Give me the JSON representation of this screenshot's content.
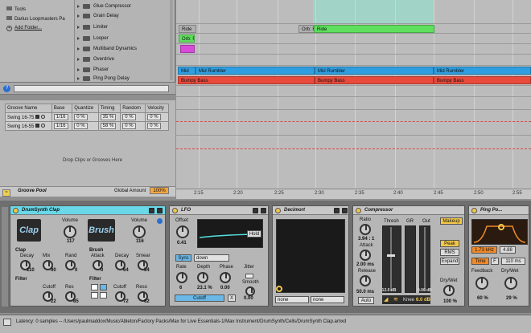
{
  "browser": {
    "places": [
      "Tools",
      "Darius Loopmasters Pa",
      "Add Folder..."
    ],
    "devices": [
      "Glue Compressor",
      "Grain Delay",
      "Limiter",
      "Looper",
      "Multiband Dynamics",
      "Overdrive",
      "Phaser",
      "Ping Pong Delay"
    ]
  },
  "search": {
    "icon": "search-icon",
    "value": ""
  },
  "groove": {
    "headers": [
      "Groove Name",
      "Base",
      "Quantize",
      "Timing",
      "Random",
      "Velocity"
    ],
    "rows": [
      {
        "name": "Swing 16-75",
        "base": "1/16",
        "quantize": "0 %",
        "timing": "35 %",
        "random": "0 %",
        "velocity": "0 %"
      },
      {
        "name": "Swing 16-55",
        "base": "1/16",
        "quantize": "0 %",
        "timing": "58 %",
        "random": "0 %",
        "velocity": "0 %"
      }
    ],
    "drop_hint": "Drop Clips or Grooves Here",
    "title": "Groove Pool",
    "global_amount_label": "Global Amount",
    "global_amount": "100%"
  },
  "arrangement": {
    "clips": {
      "ride_small": "Ride",
      "orb_ride": "Orb: R",
      "ride_main": "Ride",
      "orb_small": "Orb: R",
      "mid_a": "Mid",
      "mid_rumbler_1": "Mid Rumbler",
      "mid_rumbler_2": "Mid Rumbler",
      "mid_rumbler_3": "Mid Rumbler",
      "bumpy_1": "Bumpy Bass",
      "bumpy_2": "Bumpy Bass",
      "bumpy_3": "Bumpy Bass"
    },
    "ticks": [
      "2:15",
      "2:20",
      "2:25",
      "2:30",
      "2:35",
      "2:40",
      "2:45",
      "2:50",
      "2:55"
    ]
  },
  "drumsynth": {
    "title": "DrumSynth Clap",
    "clap_pad": "Clap",
    "brush_pad": "Brush",
    "volume_label": "Volume",
    "clap_volume": "117",
    "brush_volume": "116",
    "clap_section": "Clap",
    "decay_label": "Decay",
    "mix_label": "Mix",
    "rand_label": "Rand",
    "clap_decay": "110",
    "clap_mix": "90",
    "clap_rand": "0",
    "brush_section": "Brush",
    "attack_label": "Attack",
    "smear_label": "Smear",
    "brush_attack": "0",
    "brush_decay": "64",
    "brush_smear": "54",
    "filter_label": "Filter",
    "cutoff_label": "Cutoff",
    "res_label": "Res",
    "reso_label": "Reso",
    "clap_cutoff": "22",
    "clap_res": "85",
    "brush_cutoff": "72",
    "brush_reso": "62"
  },
  "lfo": {
    "title": "LFO",
    "offset_label": "Offset",
    "offset": "0.41",
    "hold": "Hold",
    "sync": "Sync",
    "direction": "down",
    "rate_label": "Rate",
    "depth_label": "Depth",
    "phase_label": "Phase",
    "jitter_label": "Jitter",
    "smooth_label": "Smooth",
    "rate": "6",
    "depth": "23.1 %",
    "phase": "0.00",
    "smooth": "0.00",
    "target": "Cutoff",
    "unmap": "X"
  },
  "decimort": {
    "title": "Decimort",
    "mod_a": "none",
    "mod_b": "none"
  },
  "compressor": {
    "title": "Compressor",
    "ratio_label": "Ratio",
    "ratio": "3.94 : 1",
    "attack_label": "Attack",
    "attack": "2.00 ms",
    "release_label": "Release",
    "release": "50.0 ms",
    "auto": "Auto",
    "thresh_label": "Thresh",
    "gr_label": "GR",
    "out_label": "Out",
    "thresh_val": "-12.0 dB",
    "out_val": "0.00 dB",
    "knee_label": "Knee",
    "knee": "6.0 dB",
    "makeup": "Makeup",
    "peak": "Peak",
    "rms": "RMS",
    "expand": "Expand",
    "drywet_label": "Dry/Wet",
    "drywet": "100 %"
  },
  "pingpong": {
    "title": "Ping Po...",
    "freq": "1.73 kHz",
    "q": "4.88",
    "time_val": "110 ms",
    "mode": "Time",
    "f_btn": "F",
    "feedback_label": "Feedback",
    "feedback": "60 %",
    "drywet_label": "Dry/Wet",
    "drywet": "29 %"
  },
  "status": {
    "text": "Latency: 0 samples -- /Users/paulmaddox/Music/Ableton/Factory Packs/Max for Live Essentials-1/Max Instrument/DrumSynth/Cells/DrumSynth Clap.amxd"
  }
}
